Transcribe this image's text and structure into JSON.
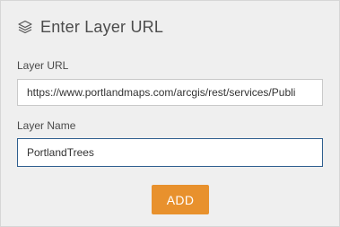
{
  "panel": {
    "title": "Enter Layer URL",
    "icon": "layers-icon"
  },
  "form": {
    "url_label": "Layer URL",
    "url_value": "https://www.portlandmaps.com/arcgis/rest/services/Publi",
    "name_label": "Layer Name",
    "name_value": "PortlandTrees"
  },
  "actions": {
    "add_label": "ADD"
  },
  "colors": {
    "accent": "#e8912d",
    "focus_border": "#2f5f8f",
    "panel_bg": "#efefef"
  }
}
